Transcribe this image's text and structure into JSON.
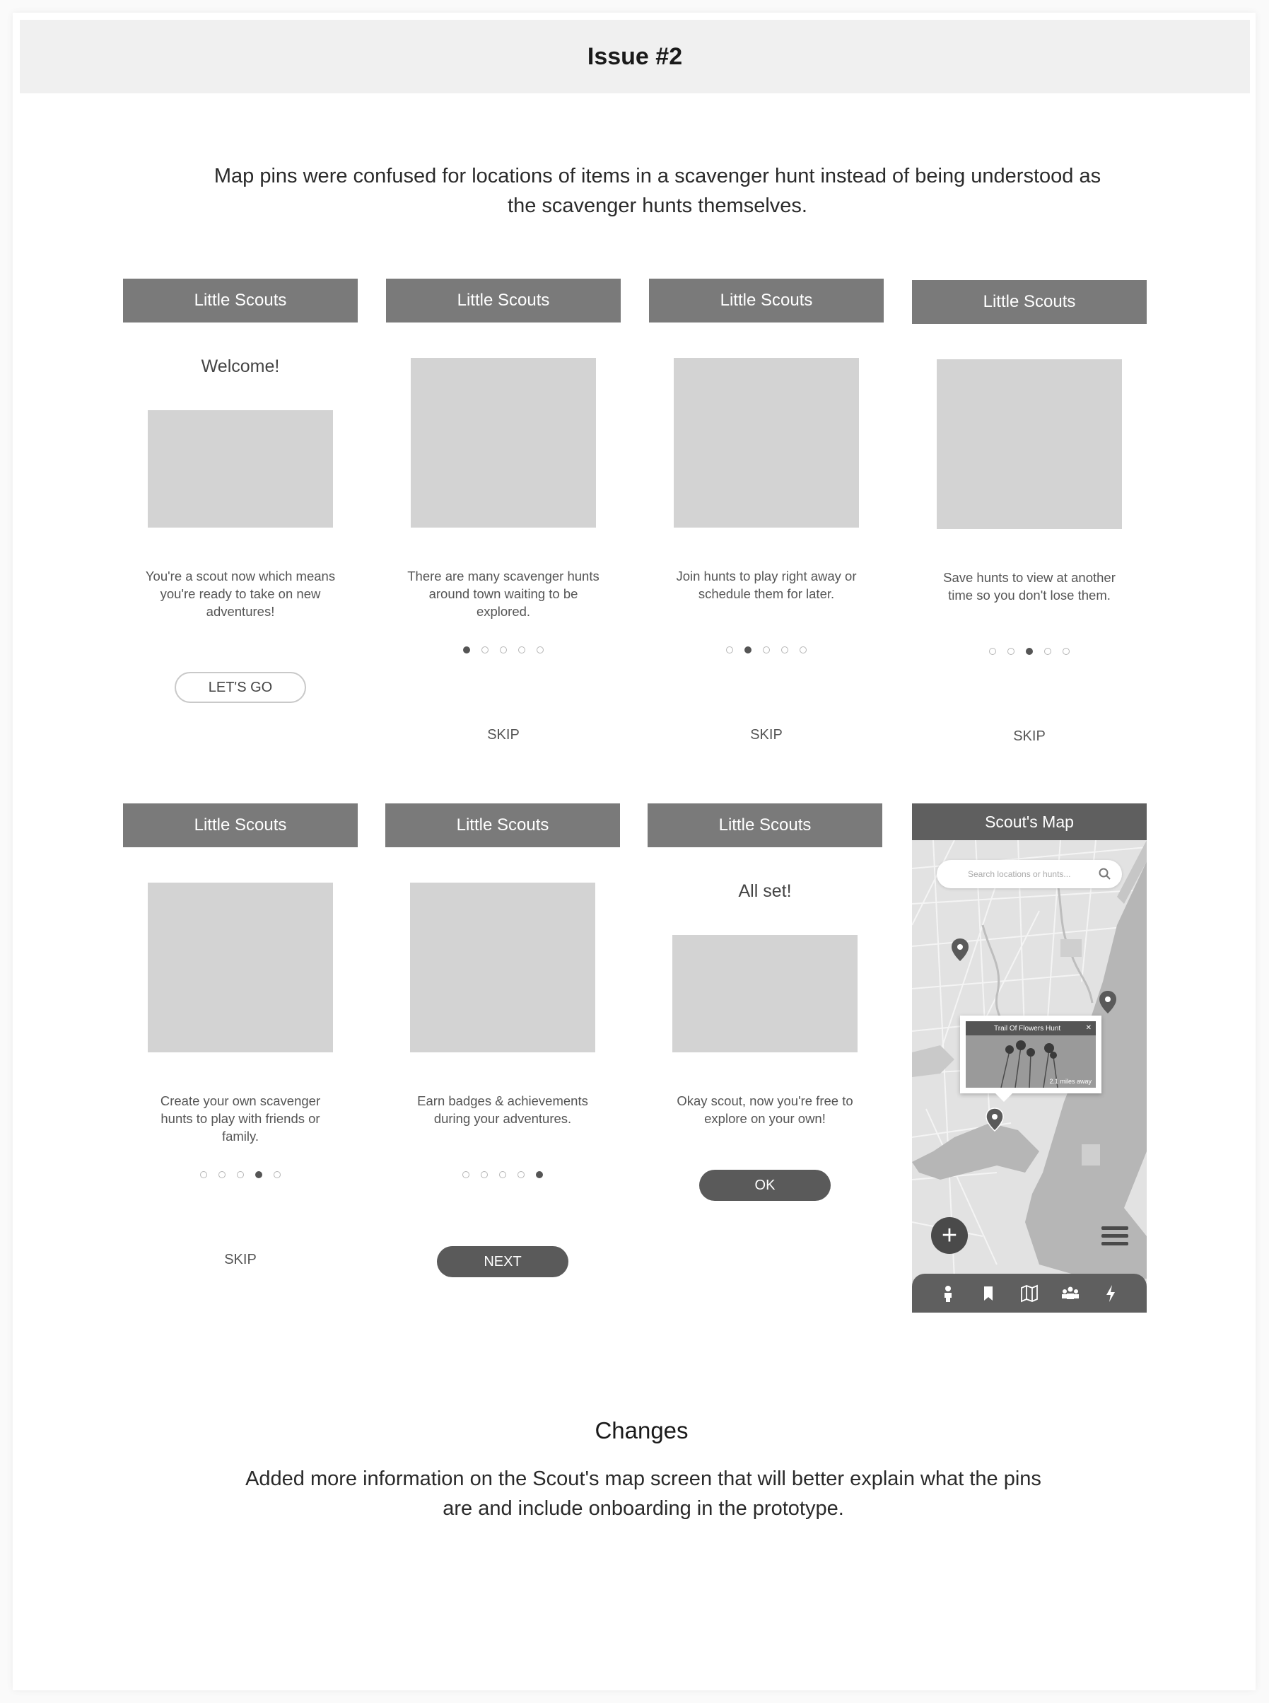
{
  "issue_title": "Issue #2",
  "intro_text": "Map pins were confused for locations of items in a scavenger hunt instead of being understood as the scavenger hunts themselves.",
  "app_name": "Little Scouts",
  "screens": [
    {
      "heading": "Welcome!",
      "caption": "You're a scout now which means you're ready to take on new adventures!",
      "button": "LET'S GO",
      "active_dot": 0
    },
    {
      "caption": "There are many scavenger hunts around town waiting to be explored.",
      "skip": "SKIP",
      "active_dot": 1
    },
    {
      "caption": "Join hunts to play right away or schedule them for later.",
      "skip": "SKIP",
      "active_dot": 2
    },
    {
      "caption": "Save hunts to view at another time so you don't lose them.",
      "skip": "SKIP",
      "active_dot": 3
    },
    {
      "caption": "Create your own scavenger hunts to play with friends or family.",
      "skip": "SKIP",
      "active_dot": 4
    },
    {
      "caption": "Earn badges & achievements during your adventures.",
      "button": "NEXT",
      "active_dot": 5
    },
    {
      "heading": "All set!",
      "caption": "Okay scout, now you're free to explore on your own!",
      "button": "OK"
    }
  ],
  "map_screen": {
    "title": "Scout's Map",
    "search_placeholder": "Search locations or hunts...",
    "popup_title": "Trail Of Flowers Hunt",
    "popup_close": "✕",
    "popup_distance": "2.1 miles away",
    "fab_label": "+",
    "nav_icons": [
      "person-icon",
      "bookmark-icon",
      "map-icon",
      "group-icon",
      "lightning-icon"
    ]
  },
  "changes_title": "Changes",
  "changes_text": "Added more information on the Scout's map screen that will better explain what the pins are and include onboarding in the prototype.",
  "colors": {
    "topbar": "#7a7a7a",
    "placeholder": "#d3d3d3",
    "dark_button": "#5a5a5a",
    "map_bar": "#5f5f5f"
  }
}
